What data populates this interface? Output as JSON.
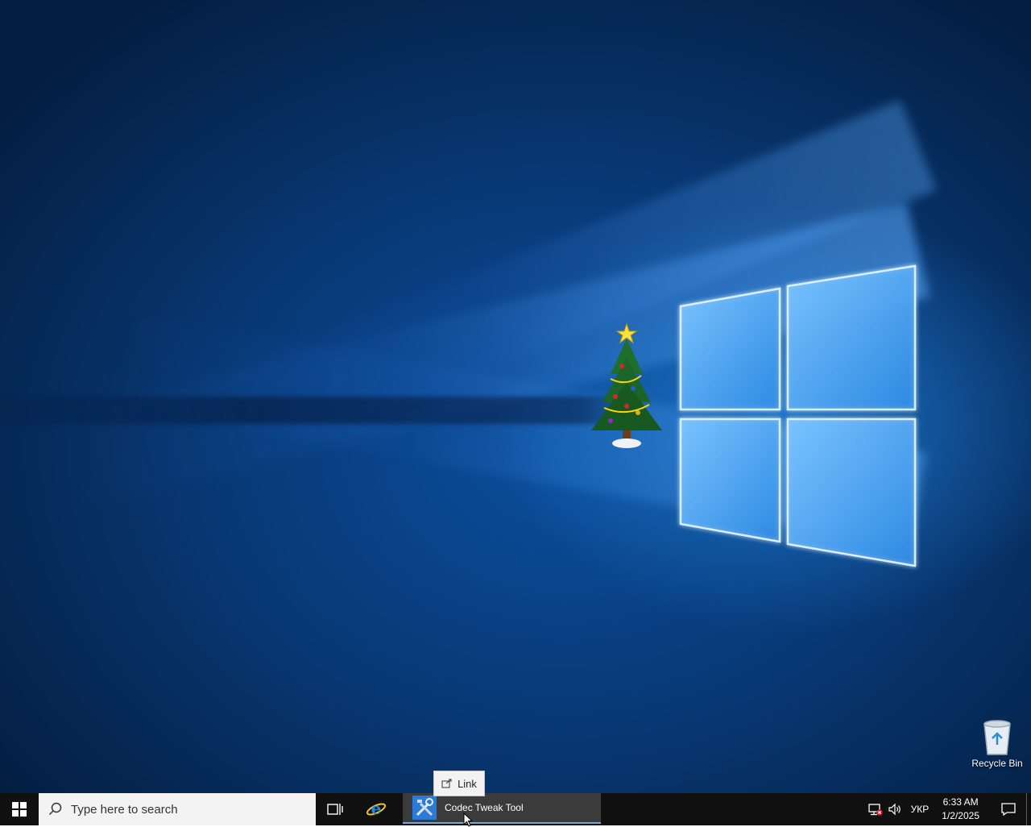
{
  "desktop": {
    "recycle_bin_label": "Recycle Bin"
  },
  "tooltip": {
    "label": "Link"
  },
  "taskbar": {
    "search_placeholder": "Type here to search",
    "running_app_label": "Codec Tweak Tool",
    "language": "УКР",
    "time": "6:33 AM",
    "date": "1/2/2025"
  },
  "icons": {
    "start": "windows-logo-icon",
    "search": "search-icon",
    "task_view": "task-view-icon",
    "browser": "internet-explorer-icon",
    "app": "codec-tweak-tool-icon",
    "network": "network-disconnected-icon",
    "volume": "volume-icon",
    "notifications": "action-center-icon",
    "recycle_bin": "recycle-bin-icon",
    "link": "link-icon",
    "tree": "christmas-tree-icon"
  },
  "colors": {
    "taskbar_bg": "#101010",
    "active_app_bg": "#3b3b3b",
    "active_app_accent": "#7aa7d8",
    "search_bg": "#f3f3f3",
    "wallpaper_blue": "#0b4f9e"
  }
}
